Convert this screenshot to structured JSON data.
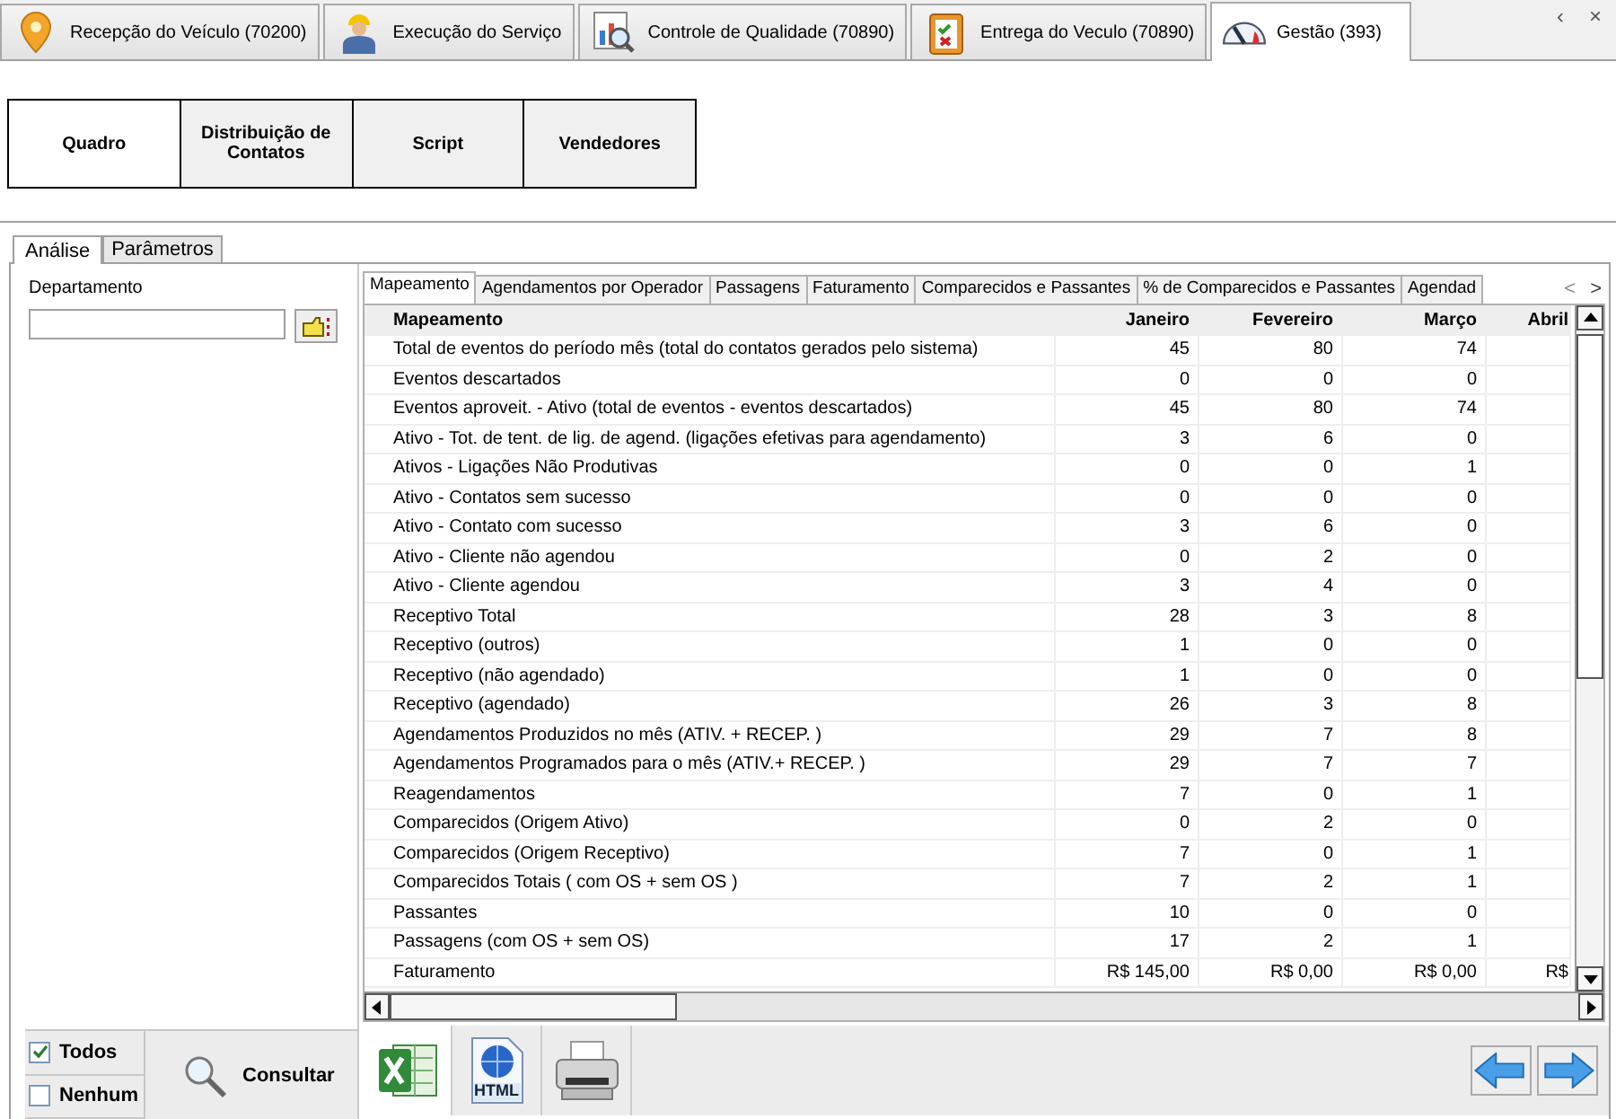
{
  "module_tabs": [
    {
      "label": "Recepção do Veículo (70200)",
      "selected": false
    },
    {
      "label": "Execução do Serviço",
      "selected": false
    },
    {
      "label": "Controle de Qualidade (70890)",
      "selected": false
    },
    {
      "label": "Entrega do Veculo (70890)",
      "selected": false
    },
    {
      "label": "Gestão (393)",
      "selected": true
    }
  ],
  "tab_scroll": [
    "‹",
    "×"
  ],
  "view_buttons": [
    {
      "label": "Quadro",
      "selected": true
    },
    {
      "label": "Distribuição de Contatos",
      "selected": false
    },
    {
      "label": "Script",
      "selected": false
    },
    {
      "label": "Vendedores",
      "selected": false
    }
  ],
  "panel_tabs": [
    {
      "label": "Análise",
      "selected": true
    },
    {
      "label": "Parâmetros",
      "selected": false
    }
  ],
  "filter": {
    "label": "Departamento"
  },
  "report_tabs": [
    {
      "label": "Mapeamento",
      "selected": true
    },
    {
      "label": "Agendamentos por Operador",
      "selected": false
    },
    {
      "label": "Passagens",
      "selected": false
    },
    {
      "label": "Faturamento",
      "selected": false
    },
    {
      "label": "Comparecidos e Passantes",
      "selected": false
    },
    {
      "label": "% de Comparecidos e Passantes",
      "selected": false
    },
    {
      "label": "Agendad",
      "selected": false
    }
  ],
  "report_tab_scroll": [
    "<",
    ">"
  ],
  "table": {
    "columns": [
      "Mapeamento",
      "Janeiro",
      "Fevereiro",
      "Março",
      "Abril"
    ],
    "rows": [
      {
        "label": "Total de eventos do período mês (total do contatos gerados pelo sistema)",
        "values": [
          "45",
          "80",
          "74"
        ]
      },
      {
        "label": "Eventos descartados",
        "values": [
          "0",
          "0",
          "0"
        ]
      },
      {
        "label": "Eventos aproveit. - Ativo (total de eventos - eventos descartados)",
        "values": [
          "45",
          "80",
          "74"
        ]
      },
      {
        "label": "Ativo - Tot. de tent. de lig. de agend. (ligações efetivas para agendamento)",
        "values": [
          "3",
          "6",
          "0"
        ]
      },
      {
        "label": "Ativos - Ligações Não Produtivas",
        "values": [
          "0",
          "0",
          "1"
        ]
      },
      {
        "label": "Ativo - Contatos sem sucesso",
        "values": [
          "0",
          "0",
          "0"
        ]
      },
      {
        "label": "Ativo - Contato com sucesso",
        "values": [
          "3",
          "6",
          "0"
        ]
      },
      {
        "label": "Ativo - Cliente não agendou",
        "values": [
          "0",
          "2",
          "0"
        ]
      },
      {
        "label": "Ativo - Cliente agendou",
        "values": [
          "3",
          "4",
          "0"
        ]
      },
      {
        "label": "Receptivo Total",
        "values": [
          "28",
          "3",
          "8"
        ]
      },
      {
        "label": "Receptivo (outros)",
        "values": [
          "1",
          "0",
          "0"
        ]
      },
      {
        "label": "Receptivo (não agendado)",
        "values": [
          "1",
          "0",
          "0"
        ]
      },
      {
        "label": "Receptivo (agendado)",
        "values": [
          "26",
          "3",
          "8"
        ]
      },
      {
        "label": "Agendamentos Produzidos no mês (ATIV. + RECEP. )",
        "values": [
          "29",
          "7",
          "8"
        ]
      },
      {
        "label": "Agendamentos Programados para o mês (ATIV.+ RECEP. )",
        "values": [
          "29",
          "7",
          "7"
        ]
      },
      {
        "label": "Reagendamentos",
        "values": [
          "7",
          "0",
          "1"
        ]
      },
      {
        "label": "Comparecidos (Origem Ativo)",
        "values": [
          "0",
          "2",
          "0"
        ]
      },
      {
        "label": "Comparecidos (Origem Receptivo)",
        "values": [
          "7",
          "0",
          "1"
        ]
      },
      {
        "label": "Comparecidos Totais ( com OS + sem OS )",
        "values": [
          "7",
          "2",
          "1"
        ]
      },
      {
        "label": "Passantes",
        "values": [
          "10",
          "0",
          "0"
        ]
      },
      {
        "label": "Passagens  (com OS + sem OS)",
        "values": [
          "17",
          "2",
          "1"
        ]
      },
      {
        "label": "Faturamento",
        "values": [
          "R$ 145,00",
          "R$ 0,00",
          "R$ 0,00",
          "R$"
        ]
      }
    ]
  },
  "selection": [
    {
      "label": "Todos",
      "checked": true
    },
    {
      "label": "Nenhum",
      "checked": false
    }
  ],
  "search_button": "Consultar",
  "export_buttons": [
    {
      "kind": "excel"
    },
    {
      "kind": "html",
      "label": "HTML"
    },
    {
      "kind": "print"
    }
  ]
}
